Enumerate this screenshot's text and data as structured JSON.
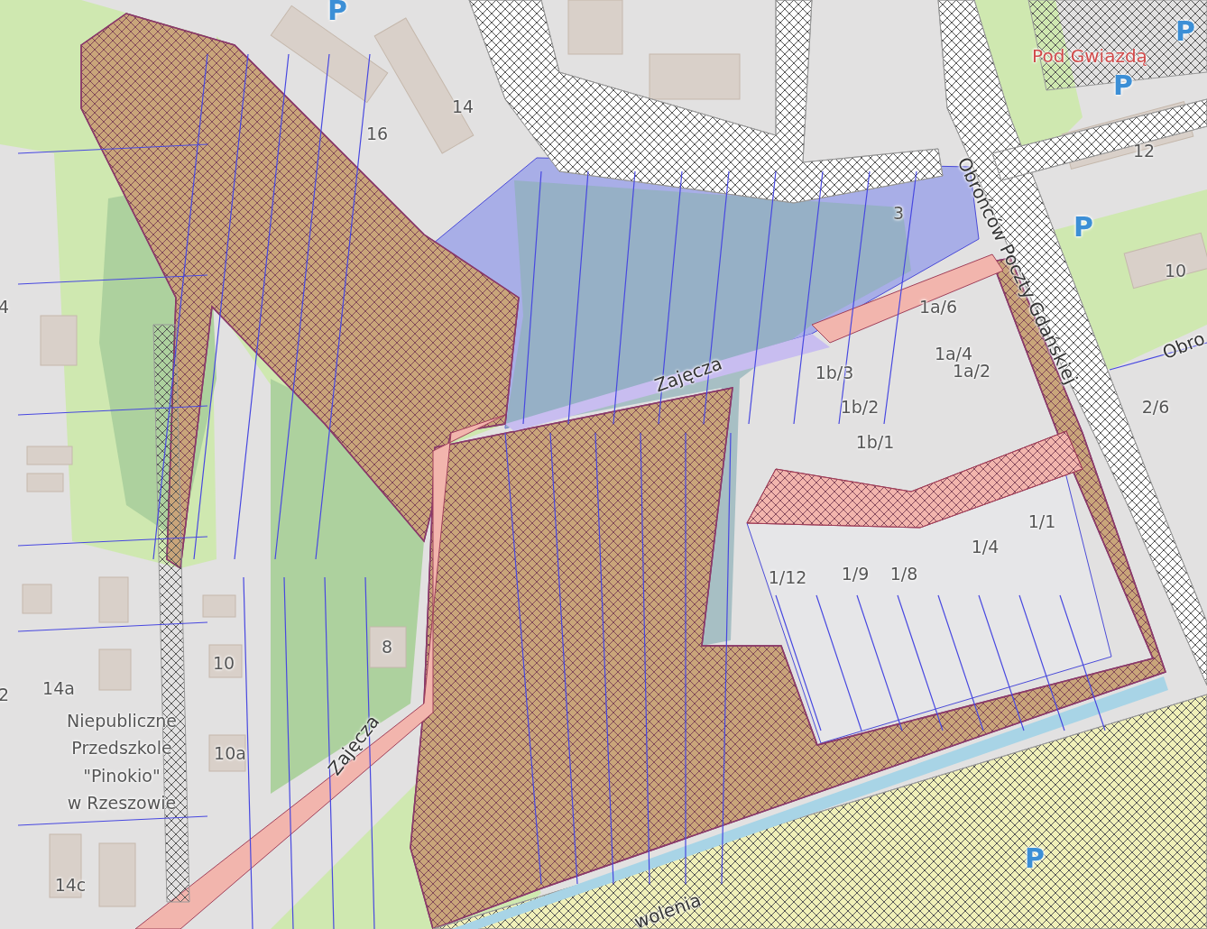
{
  "map": {
    "labels": [
      {
        "text": "P",
        "kind": "parking"
      },
      {
        "text": "P",
        "kind": "parking"
      },
      {
        "text": "Pod Gwiazdą",
        "kind": "place"
      },
      {
        "text": "P",
        "kind": "parking"
      },
      {
        "text": "12",
        "kind": "house"
      },
      {
        "text": "P",
        "kind": "parking"
      },
      {
        "text": "10",
        "kind": "house"
      },
      {
        "text": "Obro",
        "kind": "street"
      },
      {
        "text": "Obrońców Poczty Gdańskiej",
        "kind": "street"
      },
      {
        "text": "14",
        "kind": "house"
      },
      {
        "text": "16",
        "kind": "house"
      },
      {
        "text": "3",
        "kind": "house"
      },
      {
        "text": "4",
        "kind": "house"
      },
      {
        "text": "1a/6",
        "kind": "house"
      },
      {
        "text": "1a/4",
        "kind": "house"
      },
      {
        "text": "1a/2",
        "kind": "house"
      },
      {
        "text": "Zajęcza",
        "kind": "street"
      },
      {
        "text": "1b/3",
        "kind": "house"
      },
      {
        "text": "1b/2",
        "kind": "house"
      },
      {
        "text": "1b/1",
        "kind": "house"
      },
      {
        "text": "2/6",
        "kind": "house"
      },
      {
        "text": "1/1",
        "kind": "house"
      },
      {
        "text": "1/4",
        "kind": "house"
      },
      {
        "text": "1/12",
        "kind": "house"
      },
      {
        "text": "1/9",
        "kind": "house"
      },
      {
        "text": "1/8",
        "kind": "house"
      },
      {
        "text": "8",
        "kind": "house"
      },
      {
        "text": "10",
        "kind": "house"
      },
      {
        "text": "2",
        "kind": "house"
      },
      {
        "text": "14a",
        "kind": "house"
      },
      {
        "text": "Niepubliczne\nPrzedszkole\n\"Pinokio\"\nw Rzeszowie",
        "kind": "poi"
      },
      {
        "text": "10a",
        "kind": "house"
      },
      {
        "text": "Zajęcza",
        "kind": "street"
      },
      {
        "text": "14c",
        "kind": "house"
      },
      {
        "text": "P",
        "kind": "parking"
      },
      {
        "text": "wolenia",
        "kind": "street"
      }
    ]
  }
}
